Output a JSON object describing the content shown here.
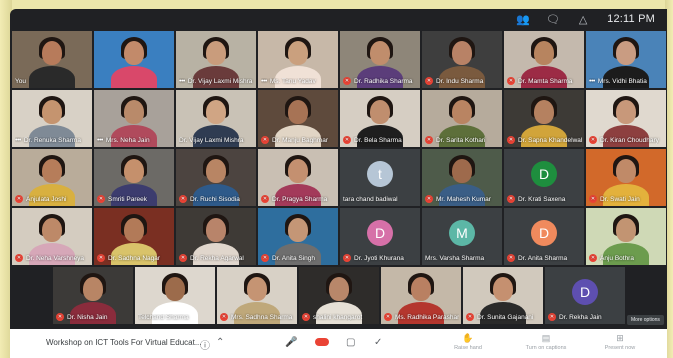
{
  "topbar": {
    "icons": [
      "people-icon",
      "chat-icon",
      "activities-icon"
    ],
    "time": "12:11 PM"
  },
  "meeting_title": "Workshop on ICT Tools For Virtual Educat...",
  "more_options": "More options",
  "bottom_actions": [
    {
      "label": "Raise hand",
      "icon": "hand-icon"
    },
    {
      "label": "Turn on captions",
      "icon": "captions-icon"
    },
    {
      "label": "Present now",
      "icon": "present-icon"
    }
  ],
  "rows": [
    [
      {
        "name": "You",
        "muted": false,
        "kind": "video",
        "bg": "#7a6a58",
        "skin": "#b77b5b",
        "cloth": "#2a2a2a"
      },
      {
        "name": "",
        "muted": false,
        "kind": "video",
        "bg": "#3a7fc0",
        "skin": "#c28a6a",
        "cloth": "#d9486a"
      },
      {
        "name": "Dr. Vijay Laxmi Mishra",
        "muted": false,
        "dots": true,
        "kind": "video",
        "bg": "#b8b2a4",
        "skin": "#c99c7c",
        "cloth": "#6a3b3b"
      },
      {
        "name": "Ms. Tanu Yadav",
        "muted": false,
        "dots": true,
        "kind": "video",
        "bg": "#c7b8a8",
        "skin": "#caa07e",
        "cloth": "#f0e1d6"
      },
      {
        "name": "Dr. Radhika Sharma",
        "muted": true,
        "kind": "video",
        "bg": "#8e8679",
        "skin": "#c08d6c",
        "cloth": "#5b3d7a"
      },
      {
        "name": "Dr. Indu Sharma",
        "muted": true,
        "kind": "video",
        "bg": "#3e3e3e",
        "skin": "#b88266",
        "cloth": "#7a5a3e"
      },
      {
        "name": "Dr. Mamta Sharma",
        "muted": true,
        "kind": "video",
        "bg": "#c4b9ad",
        "skin": "#b7845f",
        "cloth": "#9c2b45"
      },
      {
        "name": "Mrs. Vidhi Bhatia",
        "muted": false,
        "dots": true,
        "kind": "video",
        "bg": "#4a83b8",
        "skin": "#c99c82",
        "cloth": "#1c1c1c"
      }
    ],
    [
      {
        "name": "Dr. Renuka Sharma",
        "muted": false,
        "dots": true,
        "kind": "video",
        "bg": "#d8d1c6",
        "skin": "#c5946f",
        "cloth": "#7f8a96"
      },
      {
        "name": "Mrs. Neha Jain",
        "muted": false,
        "dots": true,
        "kind": "video",
        "bg": "#a8a19a",
        "skin": "#b98a6a",
        "cloth": "#b04a5c"
      },
      {
        "name": "Dr. Vijay Laxmi Mishra",
        "muted": false,
        "kind": "video",
        "bg": "#c9c2b6",
        "skin": "#d0a584",
        "cloth": "#2f3c52"
      },
      {
        "name": "Dr. Manju Baghmar",
        "muted": true,
        "kind": "video",
        "bg": "#5e4a3c",
        "skin": "#a77355",
        "cloth": "#e1d5c5"
      },
      {
        "name": "Dr. Bela Sharma",
        "muted": true,
        "kind": "video",
        "bg": "#d6cec3",
        "skin": "#c08e6e",
        "cloth": "#1e1e1e"
      },
      {
        "name": "Dr. Sarita Kothari",
        "muted": true,
        "kind": "video",
        "bg": "#b6ab9c",
        "skin": "#b98462",
        "cloth": "#5d6f3a"
      },
      {
        "name": "Dr. Sapna Khandelwal",
        "muted": true,
        "kind": "video",
        "bg": "#3d3a36",
        "skin": "#b58160",
        "cloth": "#d1a43a"
      },
      {
        "name": "Dr. Kiran Choudhary",
        "muted": true,
        "kind": "video",
        "bg": "#e0d9cf",
        "skin": "#c8987a",
        "cloth": "#8d3f3f"
      }
    ],
    [
      {
        "name": "Anjulata Joshi",
        "muted": true,
        "kind": "video",
        "bg": "#b9ac9a",
        "skin": "#b67d5a",
        "cloth": "#d8b040"
      },
      {
        "name": "Smriti Pareek",
        "muted": true,
        "kind": "video",
        "bg": "#6c6a66",
        "skin": "#c5906c",
        "cloth": "#3c3c6e"
      },
      {
        "name": "Dr. Ruchi Sisodia",
        "muted": true,
        "kind": "video",
        "bg": "#4c4440",
        "skin": "#b88564",
        "cloth": "#2e5a8a"
      },
      {
        "name": "Dr. Pragya Sharma",
        "muted": true,
        "kind": "video",
        "bg": "#c9bfb3",
        "skin": "#c49070",
        "cloth": "#a33a5a"
      },
      {
        "name": "tara chand badiwal",
        "muted": false,
        "kind": "avatar",
        "letter": "t",
        "avatar_color": "#b6c6d6"
      },
      {
        "name": "Mr. Mahesh Kumar",
        "muted": true,
        "kind": "video",
        "bg": "#4e5b4a",
        "skin": "#9e6a4c",
        "cloth": "#3a5e86"
      },
      {
        "name": "Dr. Krati Saxena",
        "muted": true,
        "kind": "avatar",
        "letter": "D",
        "avatar_color": "#1e8e3e"
      },
      {
        "name": "Dr. Swati Jain",
        "muted": true,
        "kind": "video",
        "bg": "#d2692a",
        "skin": "#c08a68",
        "cloth": "#e3b13c"
      }
    ],
    [
      {
        "name": "Dr. Neha Varshneya",
        "muted": true,
        "kind": "video",
        "bg": "#d4ccc0",
        "skin": "#bd8968",
        "cloth": "#d6a7b8"
      },
      {
        "name": "Dr. Sadhna Nagar",
        "muted": true,
        "kind": "video",
        "bg": "#7a2f22",
        "skin": "#b27a58",
        "cloth": "#d9c36a"
      },
      {
        "name": "Dr. Rekha Agarwal",
        "muted": true,
        "kind": "video",
        "bg": "#3e3a36",
        "skin": "#b8846a",
        "cloth": "#e0d6cc"
      },
      {
        "name": "Dr. Anita Singh",
        "muted": true,
        "kind": "video",
        "bg": "#2e6e9e",
        "skin": "#c49676",
        "cloth": "#6e6e6e"
      },
      {
        "name": "Dr. Jyoti Khurana",
        "muted": true,
        "kind": "avatar",
        "letter": "D",
        "avatar_color": "#d670a8"
      },
      {
        "name": "Mrs. Varsha Sharma",
        "muted": false,
        "kind": "avatar",
        "letter": "M",
        "avatar_color": "#5cb7a6"
      },
      {
        "name": "Dr. Anita Sharma",
        "muted": true,
        "kind": "avatar",
        "letter": "D",
        "avatar_color": "#f08a5d"
      },
      {
        "name": "Anju Bothra",
        "muted": true,
        "kind": "video",
        "bg": "#cfd9b6",
        "skin": "#c29472",
        "cloth": "#6c9c4e"
      }
    ],
    [
      {
        "name": "Dr. Nisha Jain",
        "muted": true,
        "kind": "video",
        "bg": "#3c3a38",
        "skin": "#b88565",
        "cloth": "#8a2c3c"
      },
      {
        "name": "Telchand Sharma",
        "muted": false,
        "kind": "video",
        "bg": "#ddd7ce",
        "skin": "#9c6b4b",
        "cloth": "#ffffff"
      },
      {
        "name": "Mrs. Sadhna Sharma",
        "muted": true,
        "kind": "video",
        "bg": "#d8d1c6",
        "skin": "#c59473",
        "cloth": "#bfa87a"
      },
      {
        "name": "shalini khangarot",
        "muted": true,
        "kind": "video",
        "bg": "#2e2c2a",
        "skin": "#b8876a",
        "cloth": "#e6e0d6"
      },
      {
        "name": "Ms. Radhika Parashar",
        "muted": true,
        "kind": "video",
        "bg": "#c4b8a8",
        "skin": "#b98062",
        "cloth": "#b4362e"
      },
      {
        "name": "Dr. Sunita Gajanani",
        "muted": true,
        "kind": "video",
        "bg": "#d1c9bd",
        "skin": "#c59070",
        "cloth": "#2a2a2a"
      },
      {
        "name": "Dr. Rekha Jain",
        "muted": true,
        "kind": "avatar",
        "letter": "D",
        "avatar_color": "#5e4fb0"
      }
    ]
  ]
}
